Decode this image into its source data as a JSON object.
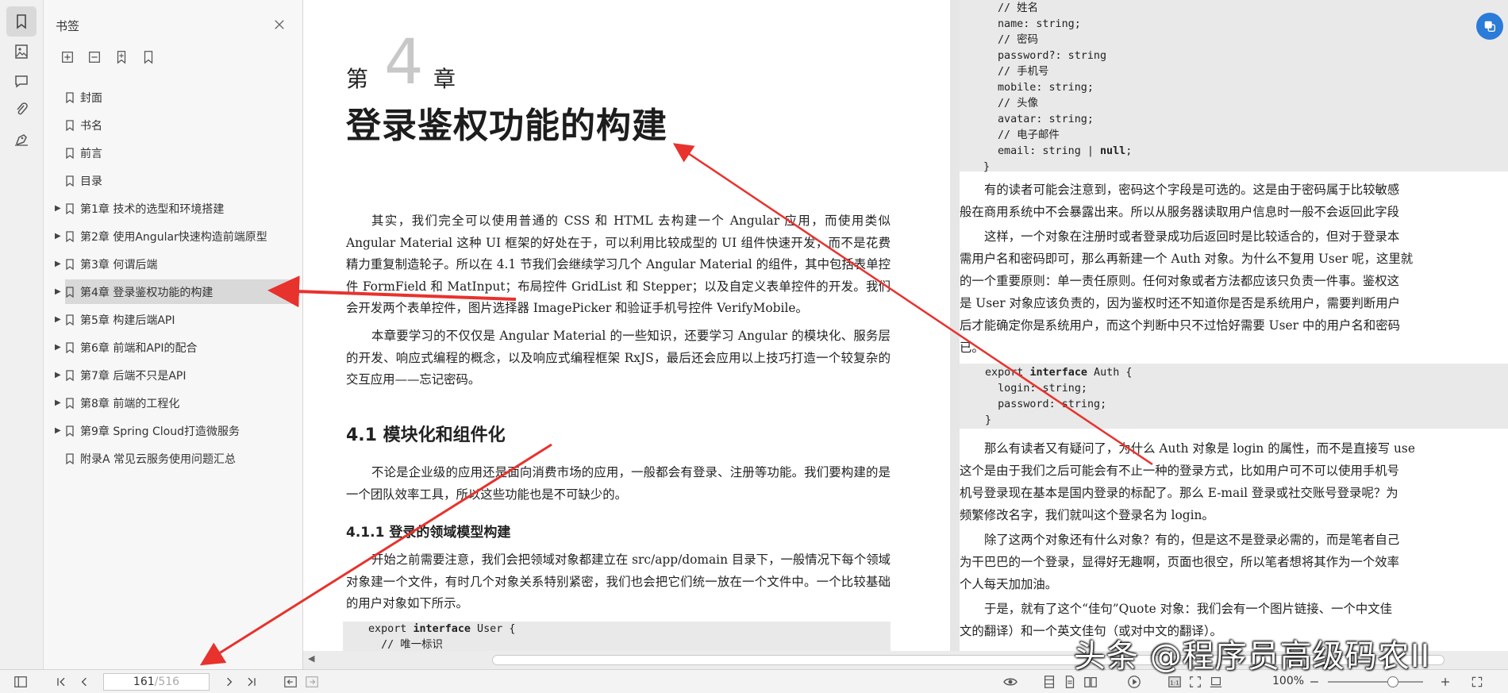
{
  "sidebar": {
    "title": "书签",
    "items": [
      {
        "label": "封面",
        "expandable": false,
        "selected": false
      },
      {
        "label": "书名",
        "expandable": false,
        "selected": false
      },
      {
        "label": "前言",
        "expandable": false,
        "selected": false
      },
      {
        "label": "目录",
        "expandable": false,
        "selected": false
      },
      {
        "label": "第1章 技术的选型和环境搭建",
        "expandable": true,
        "selected": false
      },
      {
        "label": "第2章 使用Angular快速构造前端原型",
        "expandable": true,
        "selected": false
      },
      {
        "label": "第3章 何谓后端",
        "expandable": true,
        "selected": false
      },
      {
        "label": "第4章 登录鉴权功能的构建",
        "expandable": true,
        "selected": true
      },
      {
        "label": "第5章 构建后端API",
        "expandable": true,
        "selected": false
      },
      {
        "label": "第6章 前端和API的配合",
        "expandable": true,
        "selected": false
      },
      {
        "label": "第7章 后端不只是API",
        "expandable": true,
        "selected": false
      },
      {
        "label": "第8章 前端的工程化",
        "expandable": true,
        "selected": false
      },
      {
        "label": "第9章 Spring Cloud打造微服务",
        "expandable": true,
        "selected": false
      },
      {
        "label": "附录A 常见云服务使用问题汇总",
        "expandable": false,
        "selected": false
      }
    ]
  },
  "page_left": {
    "chapter_prefix": "第",
    "chapter_number": "4",
    "chapter_suffix": "章",
    "chapter_title": "登录鉴权功能的构建",
    "intro_p1": "其实，我们完全可以使用普通的 CSS 和 HTML 去构建一个 Angular 应用，而使用类似 Angular Material 这种 UI 框架的好处在于，可以利用比较成型的 UI 组件快速开发，而不是花费精力重复制造轮子。所以在 4.1 节我们会继续学习几个 Angular Material 的组件，其中包括表单控件 FormField 和 MatInput；布局控件 GridList 和 Stepper；以及自定义表单控件的开发。我们会开发两个表单控件，图片选择器 ImagePicker 和验证手机号控件 VerifyMobile。",
    "intro_p2": "本章要学习的不仅仅是 Angular Material 的一些知识，还要学习 Angular 的模块化、服务层的开发、响应式编程的概念，以及响应式编程框架 RxJS，最后还会应用以上技巧打造一个较复杂的交互应用——忘记密码。",
    "section_4_1": "4.1  模块化和组件化",
    "section_4_1_p": "不论是企业级的应用还是面向消费市场的应用，一般都会有登录、注册等功能。我们要构建的是一个团队效率工具，所以这些功能也是不可缺少的。",
    "section_4_1_1": "4.1.1  登录的领域模型构建",
    "section_4_1_1_p": "开始之前需要注意，我们会把领域对象都建立在 src/app/domain 目录下，一般情况下每个领域对象建一个文件，有时几个对象关系特别紧密，我们也会把它们统一放在一个文件中。一个比较基础的用户对象如下所示。",
    "code_line1": "export interface User {",
    "code_line2": "  // 唯一标识"
  },
  "page_right": {
    "code_top": [
      "// 姓名",
      "name: string;",
      "// 密码",
      "password?: string",
      "// 手机号",
      "mobile: string;",
      "// 头像",
      "avatar: string;",
      "// 电子邮件",
      "email: string | null;",
      "}"
    ],
    "lines_p1": [
      "有的读者可能会注意到，密码这个字段是可选的。这是由于密码属于比较敏感",
      "般在商用系统中不会暴露出来。所以从服务器读取用户信息时一般不会返回此字段"
    ],
    "lines_p2": [
      "这样，一个对象在注册时或者登录成功后返回时是比较适合的，但对于登录本",
      "需用户名和密码即可，那么再新建一个 Auth 对象。为什么不复用 User 呢，这里就",
      "的一个重要原则：单一责任原则。任何对象或者方法都应该只负责一件事。鉴权这",
      "是 User 对象应该负责的，因为鉴权时还不知道你是否是系统用户，需要判断用户",
      "后才能确定你是系统用户，而这个判断中只不过恰好需要 User 中的用户名和密码",
      "已。"
    ],
    "code_mid": [
      "export interface Auth {",
      "  login: string;",
      "  password: string;",
      "}"
    ],
    "lines_p3": [
      "那么有读者又有疑问了，为什么 Auth 对象是 login 的属性，而不是直接写 use",
      "这个是由于我们之后可能会有不止一种的登录方式，比如用户可不可以使用手机号",
      "机号登录现在基本是国内登录的标配了。那么 E-mail 登录或社交账号登录呢？为",
      "频繁修改名字，我们就叫这个登录名为 login。"
    ],
    "lines_p4": [
      "除了这两个对象还有什么对象？有的，但是这不是登录必需的，而是笔者自己",
      "为干巴巴的一个登录，显得好无趣啊，页面也很空，所以笔者想将其作为一个效率",
      "个人每天加加油。"
    ],
    "lines_p5": [
      "于是，就有了这个“佳句”Quote 对象：我们会有一个图片链接、一个中文佳",
      "文的翻译）和一个英文佳句（或对中文的翻译）。"
    ]
  },
  "bottombar": {
    "current_page": "161",
    "total_pages": "/516",
    "zoom": "100%"
  },
  "watermark": "头条 @程序员高级码农II",
  "colors": {
    "accent": "#2b7bd8",
    "annotation_arrow": "#e8322d",
    "selected_bg": "#d9d9d9"
  }
}
